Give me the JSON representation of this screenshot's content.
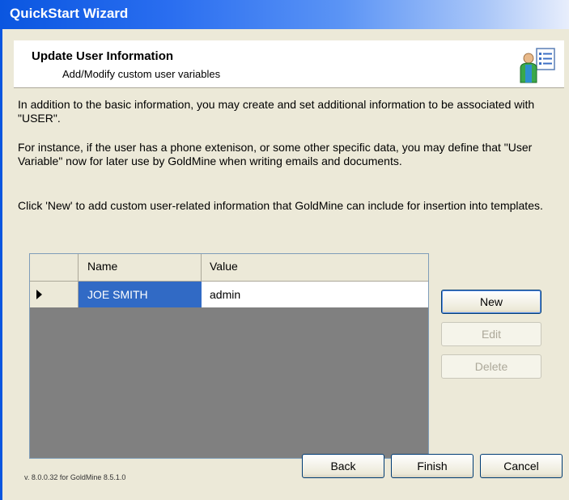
{
  "window": {
    "title": "QuickStart Wizard"
  },
  "header": {
    "title": "Update User Information",
    "subtitle": "Add/Modify custom user variables",
    "icon": "user-list-icon"
  },
  "body": {
    "paragraph1": "In addition to the basic information, you may create and set additional information to be associated with \"USER\".",
    "paragraph2": "For instance, if the user has a phone extenison, or some other specific data, you may define that \"User Variable\" now for later use by GoldMine when writing emails and documents.",
    "paragraph3": "Click 'New' to add custom user-related information that GoldMine can include for insertion into templates."
  },
  "grid": {
    "columns": [
      "Name",
      "Value"
    ],
    "rows": [
      {
        "name": "JOE SMITH",
        "value": "admin"
      }
    ]
  },
  "side_buttons": {
    "new": "New",
    "edit": "Edit",
    "delete": "Delete"
  },
  "footer": {
    "version": "v. 8.0.0.32 for GoldMine 8.5.1.0",
    "back": "Back",
    "finish": "Finish",
    "cancel": "Cancel"
  },
  "colors": {
    "titlebar": "#0a56e0",
    "selection": "#316ac5",
    "dialog_bg": "#ece9d8",
    "grid_bg": "#808080"
  }
}
